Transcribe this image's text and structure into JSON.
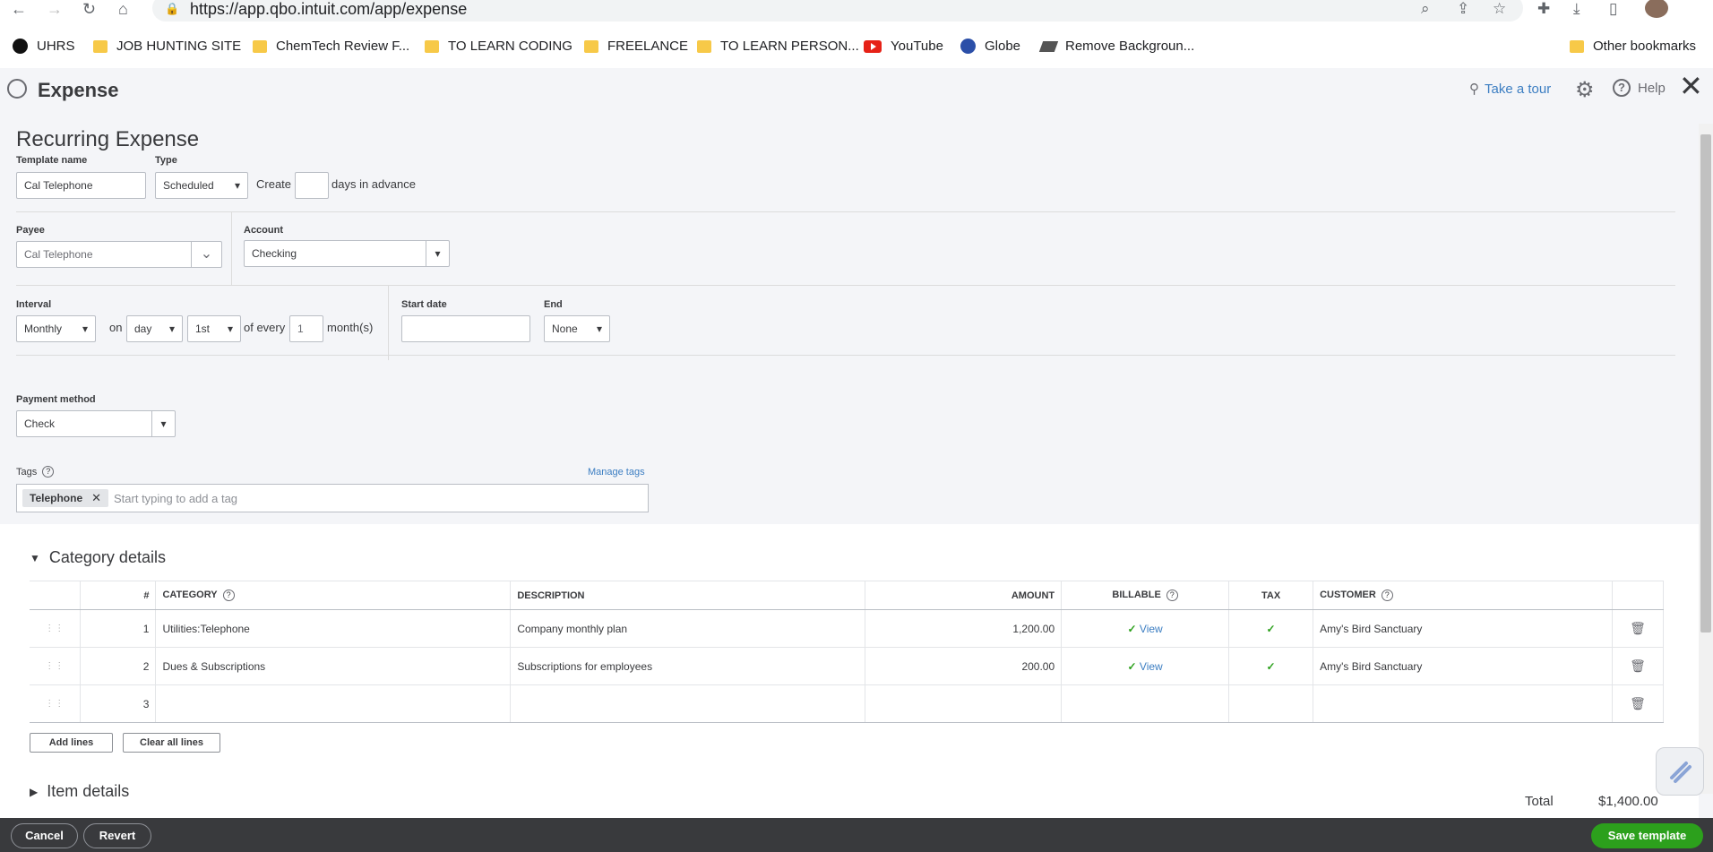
{
  "browser": {
    "url": "https://app.qbo.intuit.com/app/expense",
    "bookmarks": [
      "UHRS",
      "JOB HUNTING SITE",
      "ChemTech Review F...",
      "TO LEARN CODING",
      "FREELANCE",
      "TO LEARN PERSON...",
      "YouTube",
      "Globe",
      "Remove Backgroun..."
    ],
    "other_bookmarks": "Other bookmarks"
  },
  "header": {
    "title": "Expense",
    "take_tour": "Take a tour",
    "help": "Help"
  },
  "form": {
    "heading": "Recurring Expense",
    "template_name_label": "Template name",
    "template_name": "Cal Telephone",
    "type_label": "Type",
    "type": "Scheduled",
    "create_label": "Create",
    "days_label": "days in advance",
    "days_value": "",
    "payee_label": "Payee",
    "payee": "Cal Telephone",
    "account_label": "Account",
    "account": "Checking",
    "interval_label": "Interval",
    "interval": "Monthly",
    "on_label": "on",
    "on_value": "day",
    "day_value": "1st",
    "of_every_label": "of every",
    "every_value": "1",
    "months_label": "month(s)",
    "start_date_label": "Start date",
    "start_date": "",
    "end_label": "End",
    "end": "None",
    "payment_method_label": "Payment method",
    "payment_method": "Check",
    "tags_label": "Tags",
    "manage_tags": "Manage tags",
    "tag_chip": "Telephone",
    "tag_placeholder": "Start typing to add a tag"
  },
  "category_details": {
    "title": "Category details",
    "columns": [
      "#",
      "CATEGORY",
      "DESCRIPTION",
      "AMOUNT",
      "BILLABLE",
      "TAX",
      "CUSTOMER"
    ],
    "rows": [
      {
        "num": "1",
        "category": "Utilities:Telephone",
        "description": "Company monthly plan",
        "amount": "1,200.00",
        "billable": "View",
        "customer": "Amy's Bird Sanctuary"
      },
      {
        "num": "2",
        "category": "Dues & Subscriptions",
        "description": "Subscriptions for employees",
        "amount": "200.00",
        "billable": "View",
        "customer": "Amy's Bird Sanctuary"
      },
      {
        "num": "3",
        "category": "",
        "description": "",
        "amount": "",
        "billable": "",
        "customer": ""
      }
    ],
    "add_lines": "Add lines",
    "clear_lines": "Clear all lines"
  },
  "item_details": {
    "title": "Item details"
  },
  "totals": {
    "label": "Total",
    "value": "$1,400.00"
  },
  "footer": {
    "cancel": "Cancel",
    "revert": "Revert",
    "save": "Save template"
  }
}
